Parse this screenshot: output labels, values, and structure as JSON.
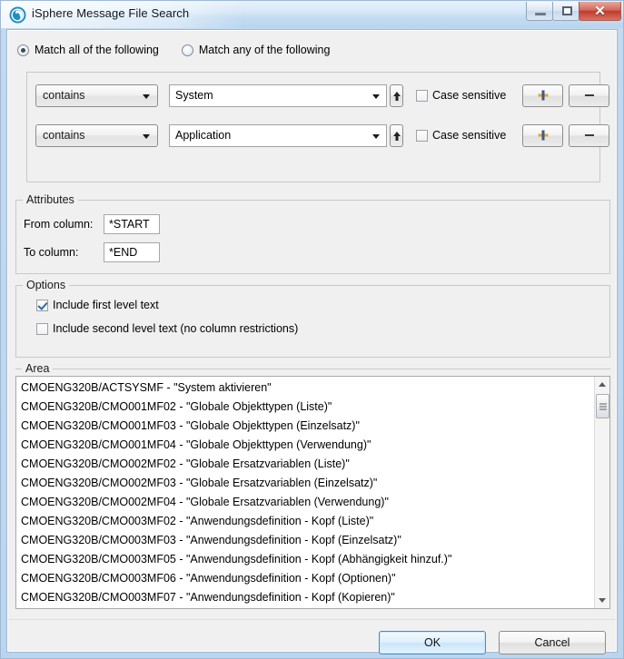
{
  "window": {
    "title": "iSphere Message File Search",
    "icon": "isphere-logo-icon",
    "caption_buttons": {
      "minimize_label": "",
      "maximize_label": "",
      "close_label": "✕"
    }
  },
  "match_mode": {
    "options": [
      {
        "label": "Match all of the following",
        "checked": true
      },
      {
        "label": "Match any of the following",
        "checked": false
      }
    ]
  },
  "criteria": {
    "rows": [
      {
        "operator": "contains",
        "value": "System",
        "case_sensitive_label": "Case sensitive",
        "case_sensitive_checked": false,
        "add_label": "+",
        "remove_label": "-"
      },
      {
        "operator": "contains",
        "value": "Application",
        "case_sensitive_label": "Case sensitive",
        "case_sensitive_checked": false,
        "add_label": "+",
        "remove_label": "-"
      }
    ]
  },
  "attributes": {
    "legend": "Attributes",
    "from_column_label": "From column:",
    "from_column_value": "*START",
    "to_column_label": "To column:",
    "to_column_value": "*END"
  },
  "options": {
    "legend": "Options",
    "items": [
      {
        "label": "Include first level text",
        "checked": true
      },
      {
        "label": "Include second level text (no column restrictions)",
        "checked": false
      }
    ]
  },
  "area": {
    "legend": "Area",
    "items": [
      "CMOENG320B/ACTSYSMF - \"System aktivieren\"",
      "CMOENG320B/CMO001MF02 - \"Globale Objekttypen (Liste)\"",
      "CMOENG320B/CMO001MF03 - \"Globale Objekttypen (Einzelsatz)\"",
      "CMOENG320B/CMO001MF04 - \"Globale Objekttypen (Verwendung)\"",
      "CMOENG320B/CMO002MF02 - \"Globale Ersatzvariablen (Liste)\"",
      "CMOENG320B/CMO002MF03 - \"Globale Ersatzvariablen (Einzelsatz)\"",
      "CMOENG320B/CMO002MF04 - \"Globale Ersatzvariablen (Verwendung)\"",
      "CMOENG320B/CMO003MF02 - \"Anwendungsdefinition - Kopf (Liste)\"",
      "CMOENG320B/CMO003MF03 - \"Anwendungsdefinition - Kopf (Einzelsatz)\"",
      "CMOENG320B/CMO003MF05 - \"Anwendungsdefinition - Kopf (Abhängigkeit hinzuf.)\"",
      "CMOENG320B/CMO003MF06 - \"Anwendungsdefinition - Kopf (Optionen)\"",
      "CMOENG320B/CMO003MF07 - \"Anwendungsdefinition - Kopf (Kopieren)\""
    ]
  },
  "footer": {
    "ok_label": "OK",
    "cancel_label": "Cancel"
  },
  "colors": {
    "window_frame": "#bcd5ee",
    "client_background": "#f0f0f0",
    "accent_focus": "#3c8fcb",
    "close_button": "#bf3b2c",
    "plus_horizontal": "#e8a33d",
    "plus_vertical": "#3b5c87"
  }
}
